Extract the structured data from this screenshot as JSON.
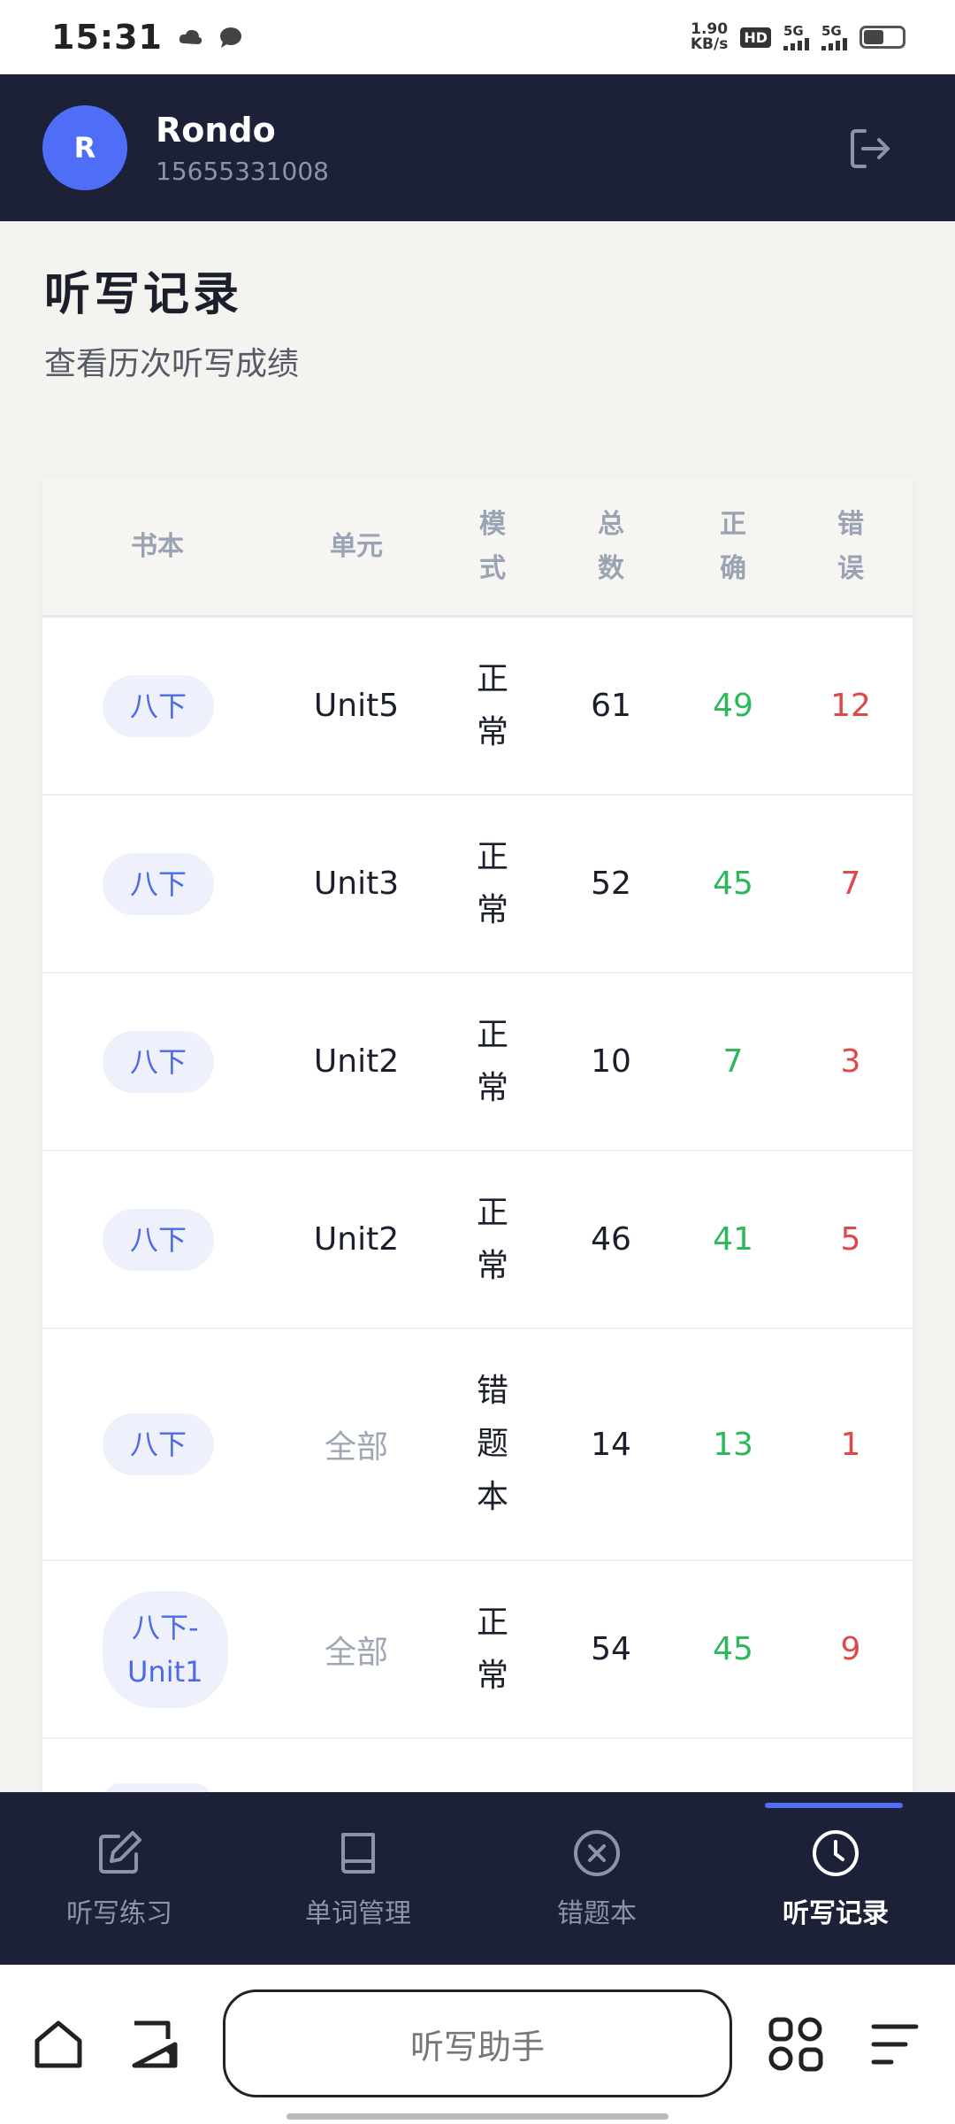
{
  "status_bar": {
    "time": "15:31",
    "net_speed_value": "1.90",
    "net_speed_unit": "KB/s",
    "hd": "HD",
    "sim1": "5G",
    "sim2": "5G"
  },
  "header": {
    "avatar_letter": "R",
    "user_name": "Rondo",
    "user_phone": "15655331008",
    "logout_icon": "logout-icon"
  },
  "page": {
    "title": "听写记录",
    "subtitle": "查看历次听写成绩"
  },
  "table": {
    "headers": {
      "book": "书本",
      "unit": "单元",
      "mode_1": "模",
      "mode_2": "式",
      "total_1": "总",
      "total_2": "数",
      "correct_1": "正",
      "correct_2": "确",
      "wrong_1": "错",
      "wrong_2": "误"
    },
    "rows": [
      {
        "book": "八下",
        "unit": "Unit5",
        "mode_1": "正",
        "mode_2": "常",
        "total": "61",
        "correct": "49",
        "wrong": "12"
      },
      {
        "book": "八下",
        "unit": "Unit3",
        "mode_1": "正",
        "mode_2": "常",
        "total": "52",
        "correct": "45",
        "wrong": "7"
      },
      {
        "book": "八下",
        "unit": "Unit2",
        "mode_1": "正",
        "mode_2": "常",
        "total": "10",
        "correct": "7",
        "wrong": "3"
      },
      {
        "book": "八下",
        "unit": "Unit2",
        "mode_1": "正",
        "mode_2": "常",
        "total": "46",
        "correct": "41",
        "wrong": "5"
      },
      {
        "book": "八下",
        "unit": "全部",
        "mode_1": "错",
        "mode_2": "题",
        "mode_3": "本",
        "total": "14",
        "correct": "13",
        "wrong": "1"
      },
      {
        "book_1": "八下-",
        "book_2": "Unit1",
        "unit": "全部",
        "mode_1": "正",
        "mode_2": "常",
        "total": "54",
        "correct": "45",
        "wrong": "9"
      }
    ]
  },
  "bottom_nav": {
    "items": [
      {
        "label": "听写练习",
        "icon": "edit-icon"
      },
      {
        "label": "单词管理",
        "icon": "book-icon"
      },
      {
        "label": "错题本",
        "icon": "close-circle-icon"
      },
      {
        "label": "听写记录",
        "icon": "clock-icon",
        "active": true
      }
    ]
  },
  "system_bar": {
    "search_label": "听写助手"
  },
  "colors": {
    "header_bg": "#1c2138",
    "accent": "#4f6ef7",
    "correct": "#2eb85c",
    "wrong": "#e04848",
    "page_bg": "#f4f3ef"
  }
}
